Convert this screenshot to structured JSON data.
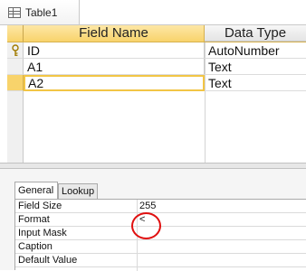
{
  "window": {
    "tab_title": "Table1",
    "icon": "table-icon"
  },
  "design_grid": {
    "columns": [
      "Field Name",
      "Data Type"
    ],
    "rows": [
      {
        "field_name": "ID",
        "data_type": "AutoNumber",
        "primary_key": true,
        "key_icon": "key-icon"
      },
      {
        "field_name": "A1",
        "data_type": "Text",
        "primary_key": false
      },
      {
        "field_name": "A2",
        "data_type": "Text",
        "primary_key": false,
        "selected": true
      }
    ]
  },
  "field_properties": {
    "tabs": [
      "General",
      "Lookup"
    ],
    "active_tab": "General",
    "properties": [
      {
        "label": "Field Size",
        "value": "255"
      },
      {
        "label": "Format",
        "value": "<",
        "highlighted": true
      },
      {
        "label": "Input Mask",
        "value": ""
      },
      {
        "label": "Caption",
        "value": ""
      },
      {
        "label": "Default Value",
        "value": ""
      }
    ]
  },
  "colors": {
    "header_active": "#f8d36b",
    "selected_row_border": "#f2c545",
    "annotation_circle": "#e01010"
  }
}
